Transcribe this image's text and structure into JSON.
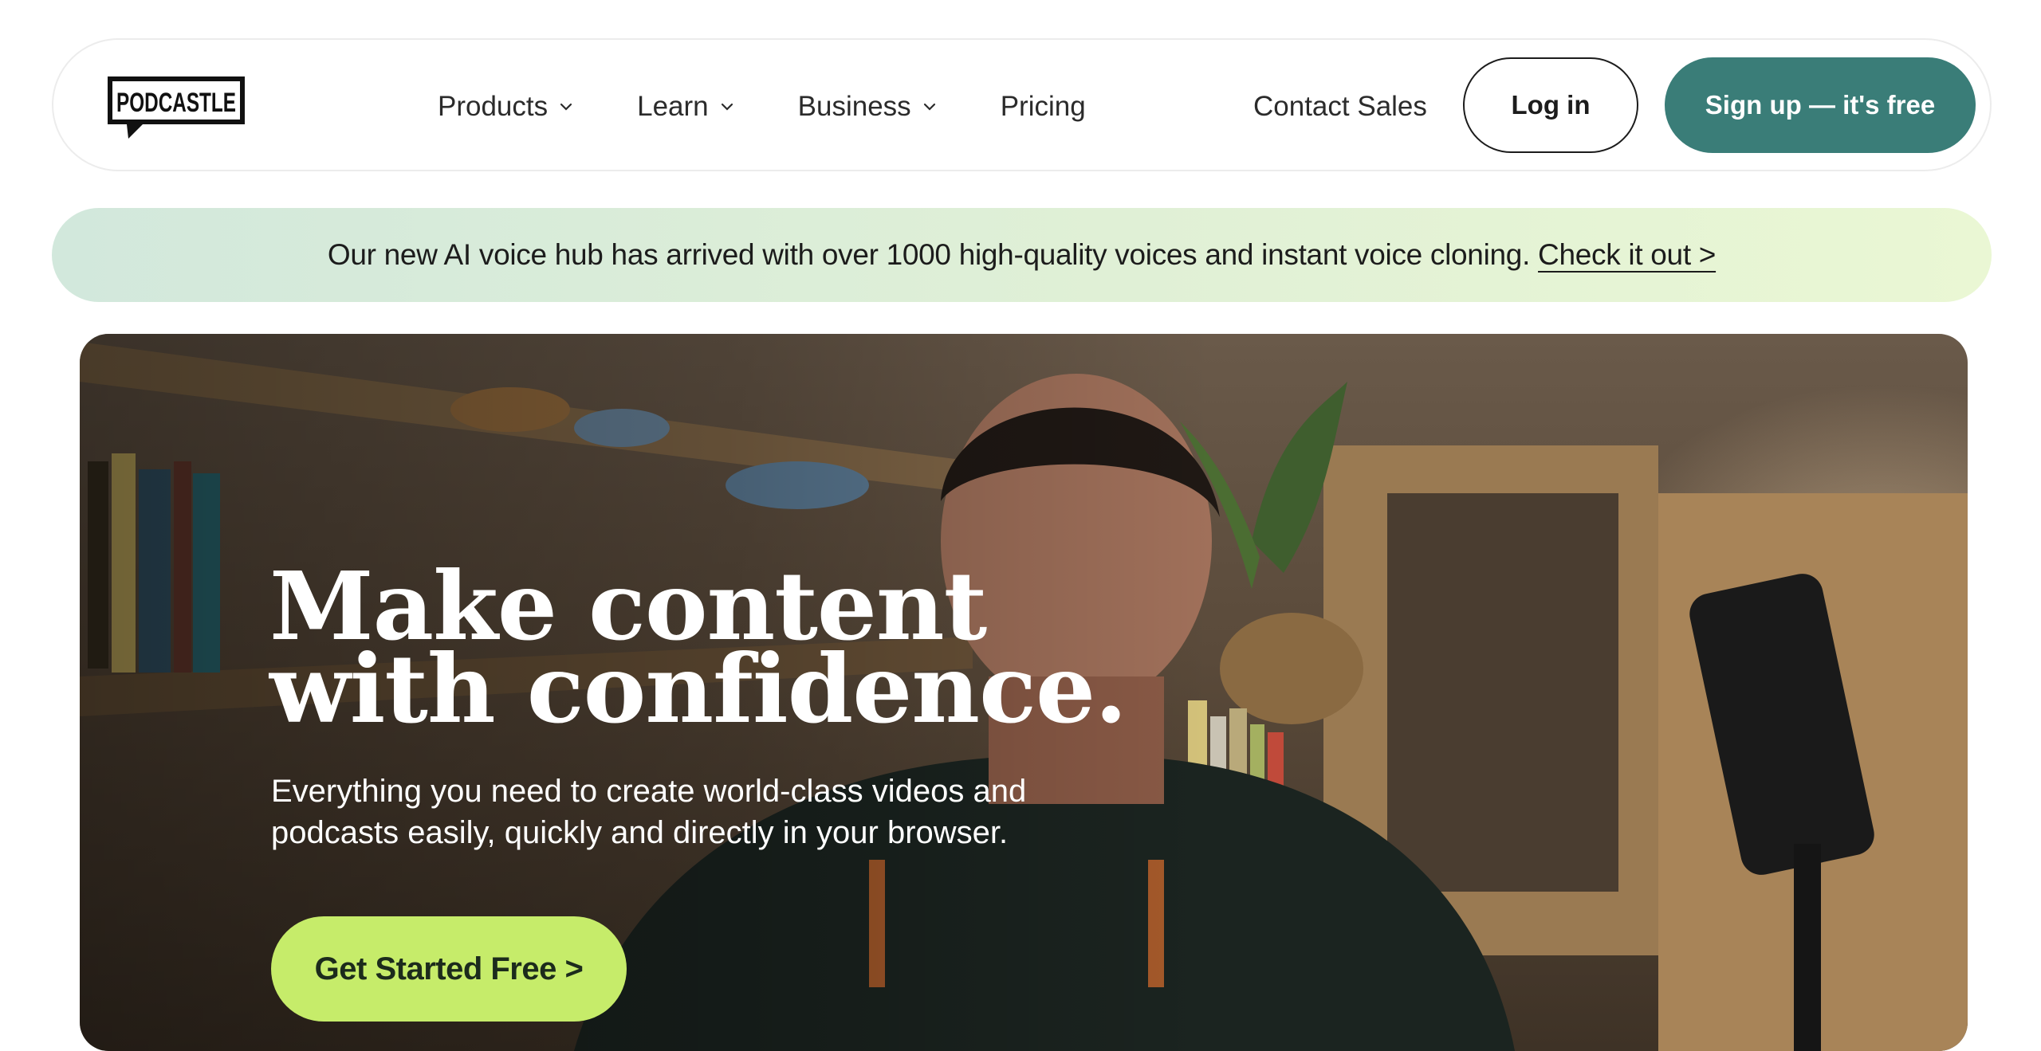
{
  "brand": {
    "name": "PODCASTLE"
  },
  "nav": {
    "items": [
      {
        "label": "Products",
        "dropdown": true
      },
      {
        "label": "Learn",
        "dropdown": true
      },
      {
        "label": "Business",
        "dropdown": true
      },
      {
        "label": "Pricing",
        "dropdown": false
      }
    ],
    "contact_sales": "Contact Sales",
    "login": "Log in",
    "signup": "Sign up — it's free"
  },
  "announcement": {
    "text": "Our new AI voice hub has arrived with over 1000 high-quality voices and instant voice cloning.",
    "link": "Check it out >"
  },
  "hero": {
    "title_line1": "Make content",
    "title_line2": "with confidence.",
    "subtitle": "Everything you need to create world-class videos and podcasts easily, quickly and directly in your browser.",
    "cta": "Get Started Free >"
  },
  "colors": {
    "accent": "#3a7d78",
    "cta": "#c6ec6a",
    "banner_start": "#d2e8dc",
    "banner_end": "#eaf7d4"
  }
}
